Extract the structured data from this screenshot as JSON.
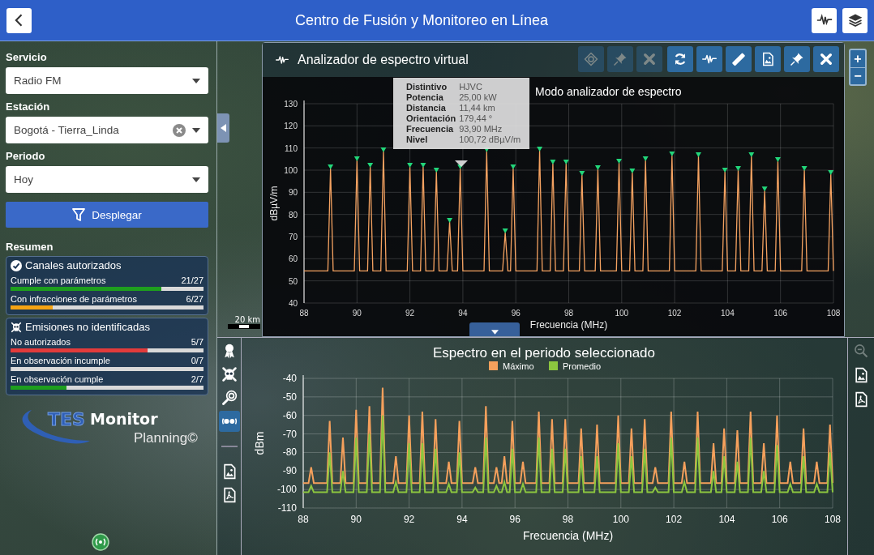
{
  "header": {
    "title": "Centro de Fusión y Monitoreo en Línea"
  },
  "filters": [
    {
      "label": "Servicio",
      "value": "Radio FM",
      "clearable": false
    },
    {
      "label": "Estación",
      "value": "Bogotá - Tierra_Linda",
      "clearable": true
    },
    {
      "label": "Periodo",
      "value": "Hoy",
      "clearable": false
    }
  ],
  "apply_button": {
    "label": "Desplegar"
  },
  "summary": {
    "title": "Resumen",
    "groups": [
      {
        "kind": "authorized",
        "title": "Canales autorizados",
        "rows": [
          {
            "label": "Cumple con parámetros",
            "count": "21/27",
            "level": 0.78,
            "color": "#1e9e1e"
          },
          {
            "label": "Con infracciones de parámetros",
            "count": "6/27",
            "level": 0.22,
            "color": "#f5a313"
          }
        ]
      },
      {
        "kind": "unidentified",
        "title": "Emisiones no identificadas",
        "rows": [
          {
            "label": "No autorizados",
            "count": "5/7",
            "level": 0.71,
            "color": "#e23b3b"
          },
          {
            "label": "En observación incumple",
            "count": "0/7",
            "level": 0
          },
          {
            "label": "En observación cumple",
            "count": "2/7",
            "level": 0.29,
            "color": "#1e9e1e"
          }
        ]
      }
    ]
  },
  "logo": {
    "mark": "TES",
    "name": "Monitor",
    "product": "Planning©"
  },
  "map": {
    "scale": "20 km"
  },
  "analyzer": {
    "title": "Analizador de espectro virtual",
    "mode_label": "Modo analizador de espectro",
    "toolbar": [
      {
        "disabled": true
      },
      {
        "disabled": true
      },
      {
        "disabled": true
      },
      {
        "disabled": false
      },
      {
        "disabled": false
      },
      {
        "disabled": false
      },
      {
        "disabled": false
      },
      {
        "disabled": false
      },
      {
        "disabled": false
      }
    ],
    "tooltip": [
      {
        "label": "Distintivo",
        "value": "HJVC"
      },
      {
        "label": "Potencia",
        "value": "25,00 kW"
      },
      {
        "label": "Distancia",
        "value": "11,44 km"
      },
      {
        "label": "Orientación",
        "value": "179,44 °"
      },
      {
        "label": "Frecuencia",
        "value": "93,90 MHz"
      },
      {
        "label": "Nivel",
        "value": "100,72 dBµV/m"
      }
    ],
    "chart_data": {
      "type": "line",
      "xlabel": "Frecuencia (MHz)",
      "ylabel": "dBµV/m",
      "grid": true,
      "x": [
        88,
        88.9,
        89,
        89.1,
        89.9,
        90,
        90.1,
        90.4,
        90.5,
        90.6,
        90.9,
        91,
        91.1,
        91.9,
        92,
        92.1,
        92.4,
        92.5,
        92.6,
        92.9,
        93,
        93.1,
        93.4,
        93.5,
        93.6,
        93.8,
        93.9,
        94,
        94.8,
        94.9,
        95,
        95.5,
        95.6,
        95.7,
        95.8,
        95.9,
        96,
        96.8,
        96.9,
        97,
        97.3,
        97.4,
        97.5,
        97.8,
        97.9,
        98,
        98.4,
        98.5,
        98.6,
        99,
        99.1,
        99.2,
        99.8,
        99.9,
        100,
        100.3,
        100.4,
        100.5,
        100.8,
        100.9,
        101,
        101.8,
        101.9,
        102,
        102.8,
        102.9,
        103,
        103.8,
        103.9,
        104,
        104.3,
        104.4,
        104.5,
        104.8,
        104.9,
        105,
        105.3,
        105.4,
        105.5,
        105.8,
        105.9,
        106,
        106.8,
        106.9,
        107,
        107.8,
        107.9,
        108
      ],
      "series": [
        {
          "color": "#f4a261",
          "values": [
            54.5,
            54.5,
            100.7,
            54.5,
            54.5,
            104.4,
            54.5,
            54.5,
            101.5,
            54.5,
            54.5,
            108.4,
            54.5,
            54.5,
            101.5,
            54.5,
            54.5,
            101.5,
            54.5,
            54.5,
            99.3,
            54.5,
            54.5,
            76.6,
            54.5,
            54.5,
            100.7,
            54.5,
            54.5,
            108.5,
            54.5,
            54.5,
            71.8,
            54.5,
            54.5,
            100.7,
            54.5,
            54.5,
            108.8,
            54.5,
            54.5,
            102.9,
            54.5,
            54.5,
            102.9,
            54.5,
            54.5,
            97.8,
            54.5,
            54.5,
            100.4,
            54.5,
            54.5,
            103.3,
            54.5,
            54.5,
            98.9,
            54.5,
            54.5,
            104.4,
            54.5,
            54.5,
            106.6,
            54.5,
            54.5,
            106.2,
            54.5,
            54.5,
            99.3,
            54.5,
            54.5,
            100.0,
            54.5,
            54.5,
            106.2,
            54.5,
            54.5,
            90.8,
            54.5,
            54.5,
            104.0,
            54.5,
            54.5,
            100.0,
            54.5,
            54.5,
            98.2,
            54.5
          ]
        }
      ],
      "xlim": [
        88,
        108
      ],
      "ylim": [
        40,
        130
      ],
      "xticks": [
        88,
        90,
        92,
        94,
        96,
        98,
        100,
        102,
        104,
        106,
        108
      ],
      "yticks": [
        40,
        50,
        60,
        70,
        80,
        90,
        100,
        110,
        120,
        130
      ]
    }
  },
  "zoom_controls": [
    "+",
    "−"
  ],
  "period_panel": {
    "tools": [
      {
        "selected": false
      },
      {
        "selected": false
      },
      {
        "selected": false
      },
      {
        "selected": true
      }
    ],
    "side_tools": [
      {
        "disabled": true
      },
      {
        "disabled": false
      },
      {
        "disabled": false
      }
    ],
    "chart_data": {
      "type": "line",
      "title": "Espectro en el periodo seleccionado",
      "xlabel": "Frecuencia (MHz)",
      "ylabel": "dBm",
      "grid": true,
      "legend": "top",
      "x": [
        88,
        88.2,
        88.3,
        88.4,
        88.9,
        89,
        89.1,
        89.4,
        89.5,
        89.6,
        89.9,
        90,
        90.1,
        90.4,
        90.5,
        90.6,
        90.9,
        91,
        91.1,
        91.4,
        91.5,
        91.6,
        91.9,
        92,
        92.1,
        92.4,
        92.5,
        92.6,
        92.9,
        93,
        93.1,
        93.4,
        93.5,
        93.6,
        93.8,
        93.9,
        94,
        94.4,
        94.5,
        94.6,
        94.8,
        94.9,
        95,
        95.2,
        95.3,
        95.4,
        95.5,
        95.6,
        95.7,
        95.8,
        95.9,
        96,
        96.2,
        96.3,
        96.4,
        96.8,
        96.9,
        97,
        97.3,
        97.4,
        97.5,
        97.8,
        97.9,
        98,
        98.4,
        98.5,
        98.6,
        99,
        99.1,
        99.2,
        99.8,
        99.9,
        100,
        100.3,
        100.4,
        100.5,
        100.8,
        100.9,
        101,
        101.2,
        101.3,
        101.4,
        101.8,
        101.9,
        102,
        102.3,
        102.4,
        102.5,
        102.8,
        102.9,
        103,
        103.4,
        103.5,
        103.6,
        103.8,
        103.9,
        104,
        104.3,
        104.4,
        104.5,
        104.8,
        104.9,
        105,
        105.3,
        105.4,
        105.5,
        105.8,
        105.9,
        106,
        106.3,
        106.4,
        106.5,
        106.8,
        106.9,
        107,
        107.3,
        107.4,
        107.5,
        107.8,
        107.9,
        108
      ],
      "series": [
        {
          "name": "Máximo",
          "color": "#f5a05c",
          "values": [
            -96.5,
            -96.5,
            -88,
            -96.5,
            -96.5,
            -63,
            -96.5,
            -96.5,
            -72,
            -96.5,
            -96.5,
            -57,
            -96.5,
            -96.5,
            -55,
            -96.5,
            -96.5,
            -45,
            -96.5,
            -96.5,
            -82,
            -96.5,
            -96.5,
            -60,
            -96.5,
            -96.5,
            -58,
            -96.5,
            -96.5,
            -62,
            -96.5,
            -96.5,
            -85,
            -96.5,
            -96.5,
            -63,
            -96.5,
            -96.5,
            -88,
            -96.5,
            -96.5,
            -55,
            -96.5,
            -96.5,
            -88,
            -96.5,
            -96.5,
            -82,
            -96.5,
            -96.5,
            -63,
            -96.5,
            -96.5,
            -85,
            -96.5,
            -96.5,
            -58,
            -96.5,
            -96.5,
            -62,
            -96.5,
            -96.5,
            -62,
            -96.5,
            -96.5,
            -67,
            -96.5,
            -96.5,
            -65,
            -96.5,
            -96.5,
            -60,
            -96.5,
            -96.5,
            -67,
            -96.5,
            -96.5,
            -62,
            -96.5,
            -96.5,
            -88,
            -96.5,
            -96.5,
            -58,
            -96.5,
            -96.5,
            -85,
            -96.5,
            -96.5,
            -58,
            -96.5,
            -96.5,
            -75,
            -96.5,
            -96.5,
            -67,
            -96.5,
            -96.5,
            -68,
            -96.5,
            -96.5,
            -58,
            -96.5,
            -96.5,
            -75,
            -96.5,
            -96.5,
            -60,
            -96.5,
            -96.5,
            -85,
            -96.5,
            -96.5,
            -67,
            -96.5,
            -96.5,
            -85,
            -96.5,
            -96.5,
            -65,
            -96.5
          ]
        },
        {
          "name": "Promedio",
          "color": "#8cc63f",
          "values": [
            -101.5,
            -101.5,
            -98,
            -101.5,
            -101.5,
            -80,
            -101.5,
            -101.5,
            -90,
            -101.5,
            -101.5,
            -72,
            -101.5,
            -101.5,
            -70,
            -101.5,
            -101.5,
            -60,
            -101.5,
            -101.5,
            -96,
            -101.5,
            -101.5,
            -75,
            -101.5,
            -101.5,
            -75,
            -101.5,
            -101.5,
            -78,
            -101.5,
            -101.5,
            -97,
            -101.5,
            -101.5,
            -80,
            -101.5,
            -101.5,
            -99,
            -101.5,
            -101.5,
            -72,
            -101.5,
            -101.5,
            -98,
            -101.5,
            -101.5,
            -96,
            -101.5,
            -101.5,
            -78,
            -101.5,
            -101.5,
            -97,
            -101.5,
            -101.5,
            -72,
            -101.5,
            -101.5,
            -78,
            -101.5,
            -101.5,
            -78,
            -101.5,
            -101.5,
            -82,
            -101.5,
            -101.5,
            -82,
            -101.5,
            -101.5,
            -75,
            -101.5,
            -101.5,
            -82,
            -101.5,
            -101.5,
            -78,
            -101.5,
            -101.5,
            -99,
            -101.5,
            -101.5,
            -72,
            -101.5,
            -101.5,
            -96,
            -101.5,
            -101.5,
            -72,
            -101.5,
            -101.5,
            -90,
            -101.5,
            -101.5,
            -82,
            -101.5,
            -101.5,
            -85,
            -101.5,
            -101.5,
            -72,
            -101.5,
            -101.5,
            -90,
            -101.5,
            -101.5,
            -76,
            -101.5,
            -101.5,
            -97,
            -101.5,
            -101.5,
            -82,
            -101.5,
            -101.5,
            -97,
            -101.5,
            -101.5,
            -80,
            -101.5
          ]
        }
      ],
      "xlim": [
        88,
        108
      ],
      "ylim": [
        -110,
        -40
      ],
      "xticks": [
        88,
        90,
        92,
        94,
        96,
        98,
        100,
        102,
        104,
        106,
        108
      ],
      "yticks": [
        -110,
        -100,
        -90,
        -80,
        -70,
        -60,
        -50,
        -40
      ]
    }
  }
}
